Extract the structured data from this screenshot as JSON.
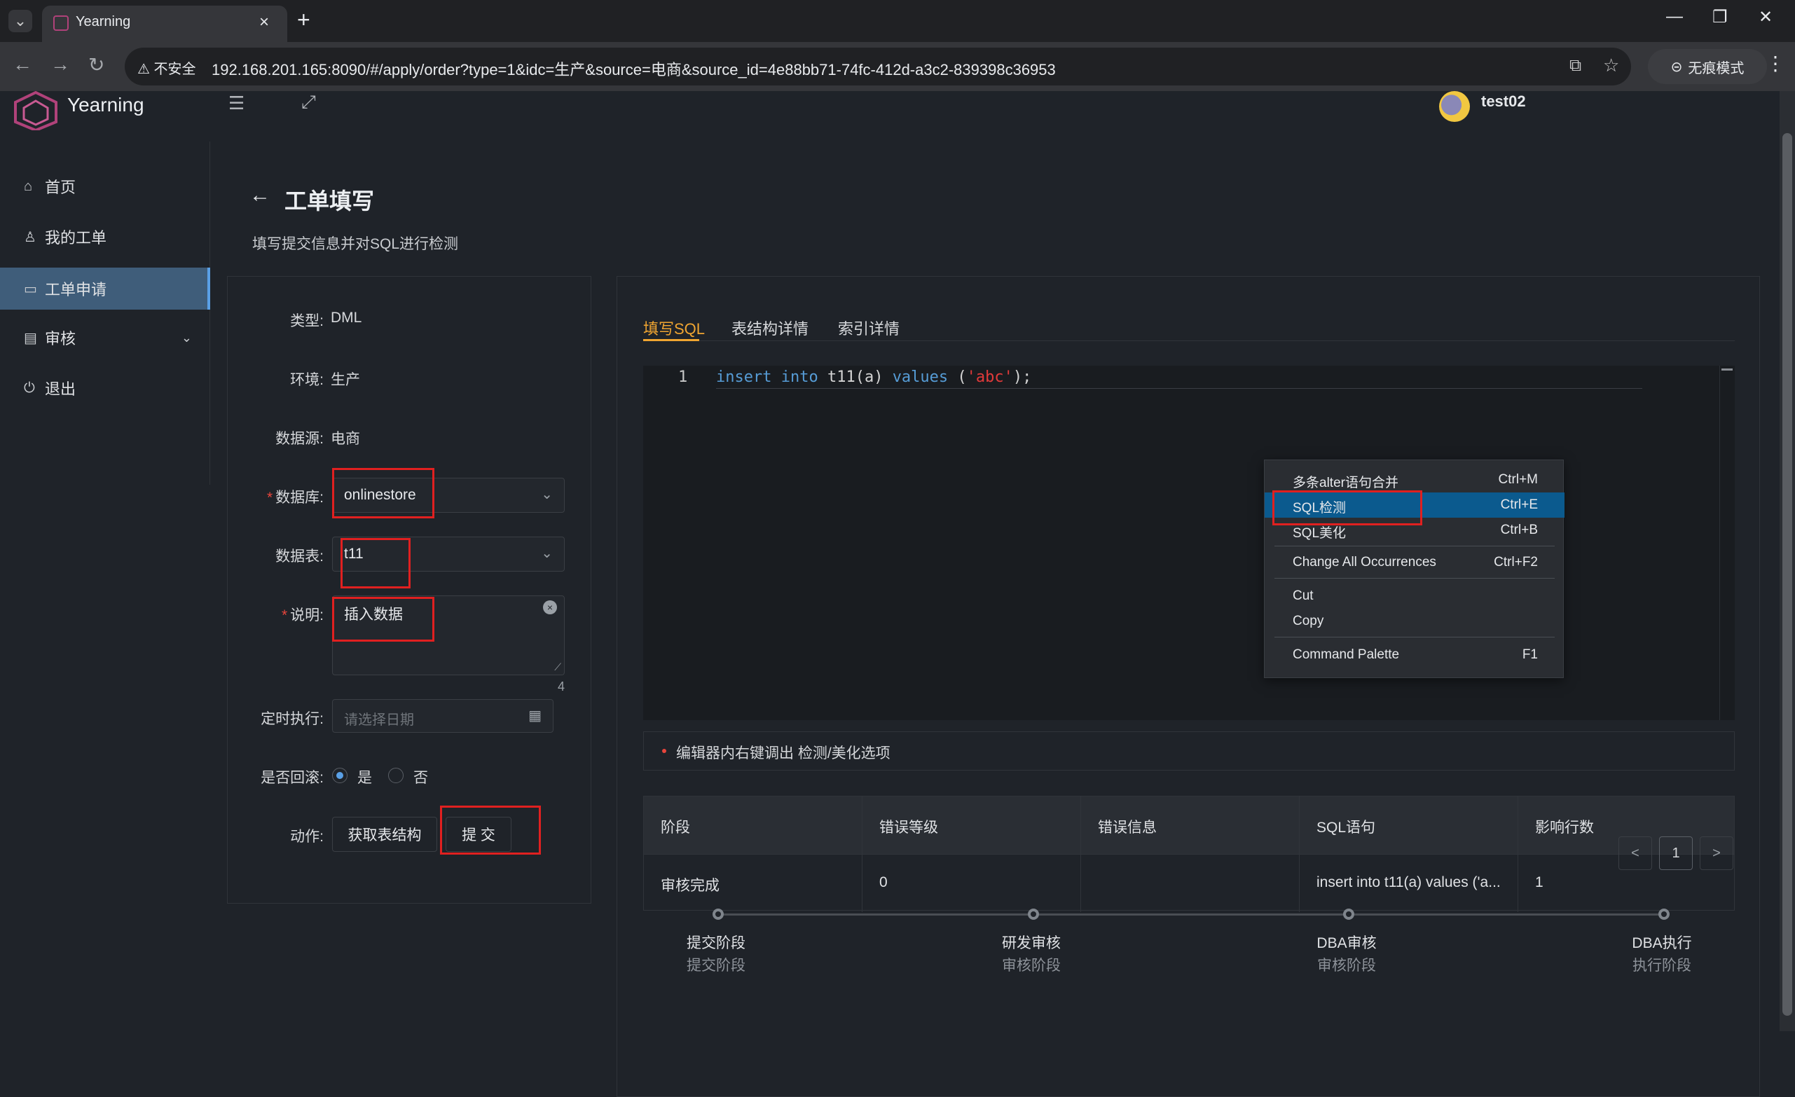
{
  "browser": {
    "tab_title": "Yearning",
    "security_label": "不安全",
    "url": "192.168.201.165:8090/#/apply/order?type=1&idc=生产&source=电商&source_id=4e88bb71-74fc-412d-a3c2-839398c36953",
    "incognito_label": "无痕模式"
  },
  "app": {
    "logo_text": "Yearning",
    "username": "test02"
  },
  "sidebar": {
    "items": [
      {
        "label": "首页",
        "icon": "home-icon"
      },
      {
        "label": "我的工单",
        "icon": "user-icon"
      },
      {
        "label": "工单申请",
        "icon": "monitor-icon"
      },
      {
        "label": "审核",
        "icon": "audit-icon"
      },
      {
        "label": "退出",
        "icon": "logout-icon"
      }
    ]
  },
  "page": {
    "title": "工单填写",
    "subtitle": "填写提交信息并对SQL进行检测"
  },
  "form": {
    "type_label": "类型:",
    "type_value": "DML",
    "env_label": "环境:",
    "env_value": "生产",
    "source_label": "数据源:",
    "source_value": "电商",
    "db_label": "数据库:",
    "db_value": "onlinestore",
    "table_label": "数据表:",
    "table_value": "t11",
    "desc_label": "说明:",
    "desc_value": "插入数据",
    "desc_count": "4",
    "schedule_label": "定时执行:",
    "schedule_placeholder": "请选择日期",
    "rollback_label": "是否回滚:",
    "rollback_yes": "是",
    "rollback_no": "否",
    "action_label": "动作:",
    "fetch_button": "获取表结构",
    "submit_button": "提 交"
  },
  "tabs": [
    "填写SQL",
    "表结构详情",
    "索引详情"
  ],
  "editor": {
    "line_number": "1",
    "kw1": "insert",
    "kw2": "into",
    "ident": " t11(a) ",
    "kw3": "values",
    "open": " (",
    "str": "'abc'",
    "close": ");"
  },
  "hint": "编辑器内右键调出 检测/美化选项",
  "context_menu": {
    "items": [
      {
        "label": "多条alter语句合并",
        "key": "Ctrl+M"
      },
      {
        "label": "SQL检测",
        "key": "Ctrl+E"
      },
      {
        "label": "SQL美化",
        "key": "Ctrl+B"
      },
      {
        "label": "Change All Occurrences",
        "key": "Ctrl+F2"
      },
      {
        "label": "Cut",
        "key": ""
      },
      {
        "label": "Copy",
        "key": ""
      },
      {
        "label": "Command Palette",
        "key": "F1"
      }
    ]
  },
  "table": {
    "headers": [
      "阶段",
      "错误等级",
      "错误信息",
      "SQL语句",
      "影响行数"
    ],
    "rows": [
      [
        "审核完成",
        "0",
        "",
        "insert into t11(a) values ('a...",
        "1"
      ]
    ]
  },
  "pagination": {
    "prev": "<",
    "current": "1",
    "next": ">"
  },
  "steps": [
    {
      "title": "提交阶段",
      "desc": "提交阶段"
    },
    {
      "title": "研发审核",
      "desc": "审核阶段"
    },
    {
      "title": "DBA审核",
      "desc": "审核阶段"
    },
    {
      "title": "DBA执行",
      "desc": "执行阶段"
    }
  ],
  "colors": {
    "accent": "#f0a531",
    "highlight": "#e02020",
    "menu_selected": "#0b5a8e"
  }
}
